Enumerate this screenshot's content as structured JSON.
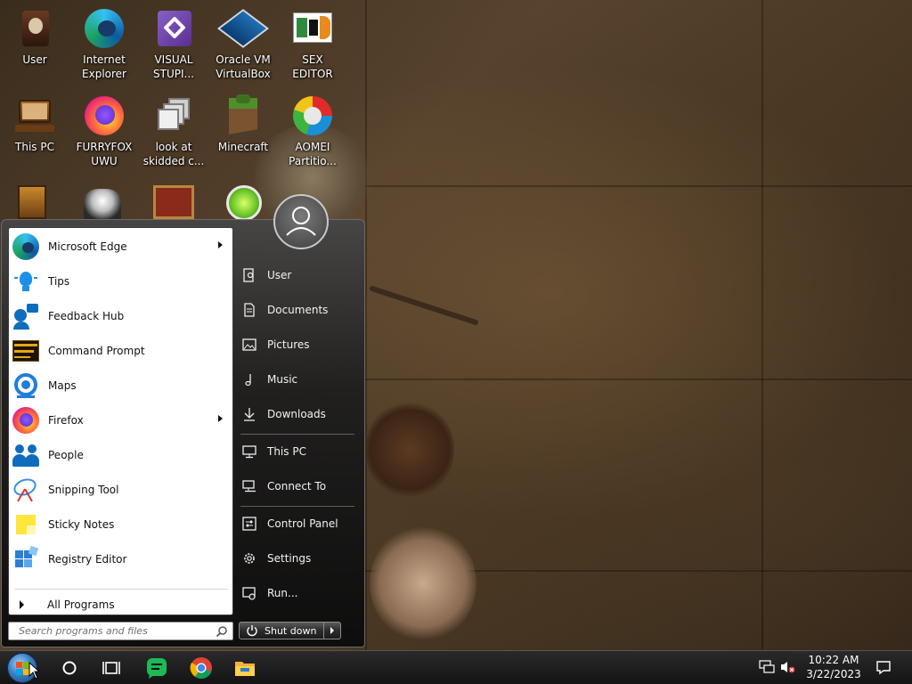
{
  "desktop": {
    "icons": [
      {
        "label": "User",
        "icon": "user-folder-icon"
      },
      {
        "label": "Internet\nExplorer",
        "icon": "edge-icon"
      },
      {
        "label": "VISUAL\nSTUPI...",
        "icon": "visual-studio-icon"
      },
      {
        "label": "Oracle VM\nVirtualBox",
        "icon": "virtualbox-icon"
      },
      {
        "label": "SEX\nEDITOR",
        "icon": "hxd-icon"
      },
      {
        "label": "This PC",
        "icon": "this-pc-icon"
      },
      {
        "label": "FURRYFOX\nUWU",
        "icon": "firefox-icon"
      },
      {
        "label": "look at\nskidded c...",
        "icon": "stacked-windows-icon"
      },
      {
        "label": "Minecraft",
        "icon": "minecraft-icon"
      },
      {
        "label": "AOMEI\nPartitio...",
        "icon": "aomei-icon"
      }
    ]
  },
  "start_menu": {
    "programs": [
      {
        "label": "Microsoft Edge",
        "icon": "edge-icon",
        "has_submenu": true
      },
      {
        "label": "Tips",
        "icon": "lightbulb-icon",
        "has_submenu": false
      },
      {
        "label": "Feedback Hub",
        "icon": "feedback-icon",
        "has_submenu": false
      },
      {
        "label": "Command Prompt",
        "icon": "command-prompt-icon",
        "has_submenu": false
      },
      {
        "label": "Maps",
        "icon": "maps-icon",
        "has_submenu": false
      },
      {
        "label": "Firefox",
        "icon": "firefox-icon",
        "has_submenu": true
      },
      {
        "label": "People",
        "icon": "people-icon",
        "has_submenu": false
      },
      {
        "label": "Snipping Tool",
        "icon": "snipping-tool-icon",
        "has_submenu": false
      },
      {
        "label": "Sticky Notes",
        "icon": "sticky-notes-icon",
        "has_submenu": false
      },
      {
        "label": "Registry Editor",
        "icon": "registry-icon",
        "has_submenu": false
      }
    ],
    "all_programs": "All Programs",
    "search_placeholder": "Search programs and files",
    "places": [
      {
        "label": "User",
        "icon": "user-folder-icon"
      },
      {
        "label": "Documents",
        "icon": "document-icon"
      },
      {
        "label": "Pictures",
        "icon": "picture-icon"
      },
      {
        "label": "Music",
        "icon": "music-note-icon"
      },
      {
        "label": "Downloads",
        "icon": "download-icon"
      },
      {
        "label": "This PC",
        "icon": "monitor-icon"
      },
      {
        "label": "Connect To",
        "icon": "connect-icon"
      },
      {
        "label": "Control Panel",
        "icon": "control-panel-icon"
      },
      {
        "label": "Settings",
        "icon": "gear-icon"
      },
      {
        "label": "Run...",
        "icon": "run-icon"
      }
    ],
    "shutdown_label": "Shut down"
  },
  "taskbar": {
    "pinned": [
      "cortana-icon",
      "task-view-icon",
      "chat-app-icon",
      "chrome-icon",
      "file-explorer-icon"
    ],
    "time": "10:22 AM",
    "date": "3/22/2023"
  }
}
